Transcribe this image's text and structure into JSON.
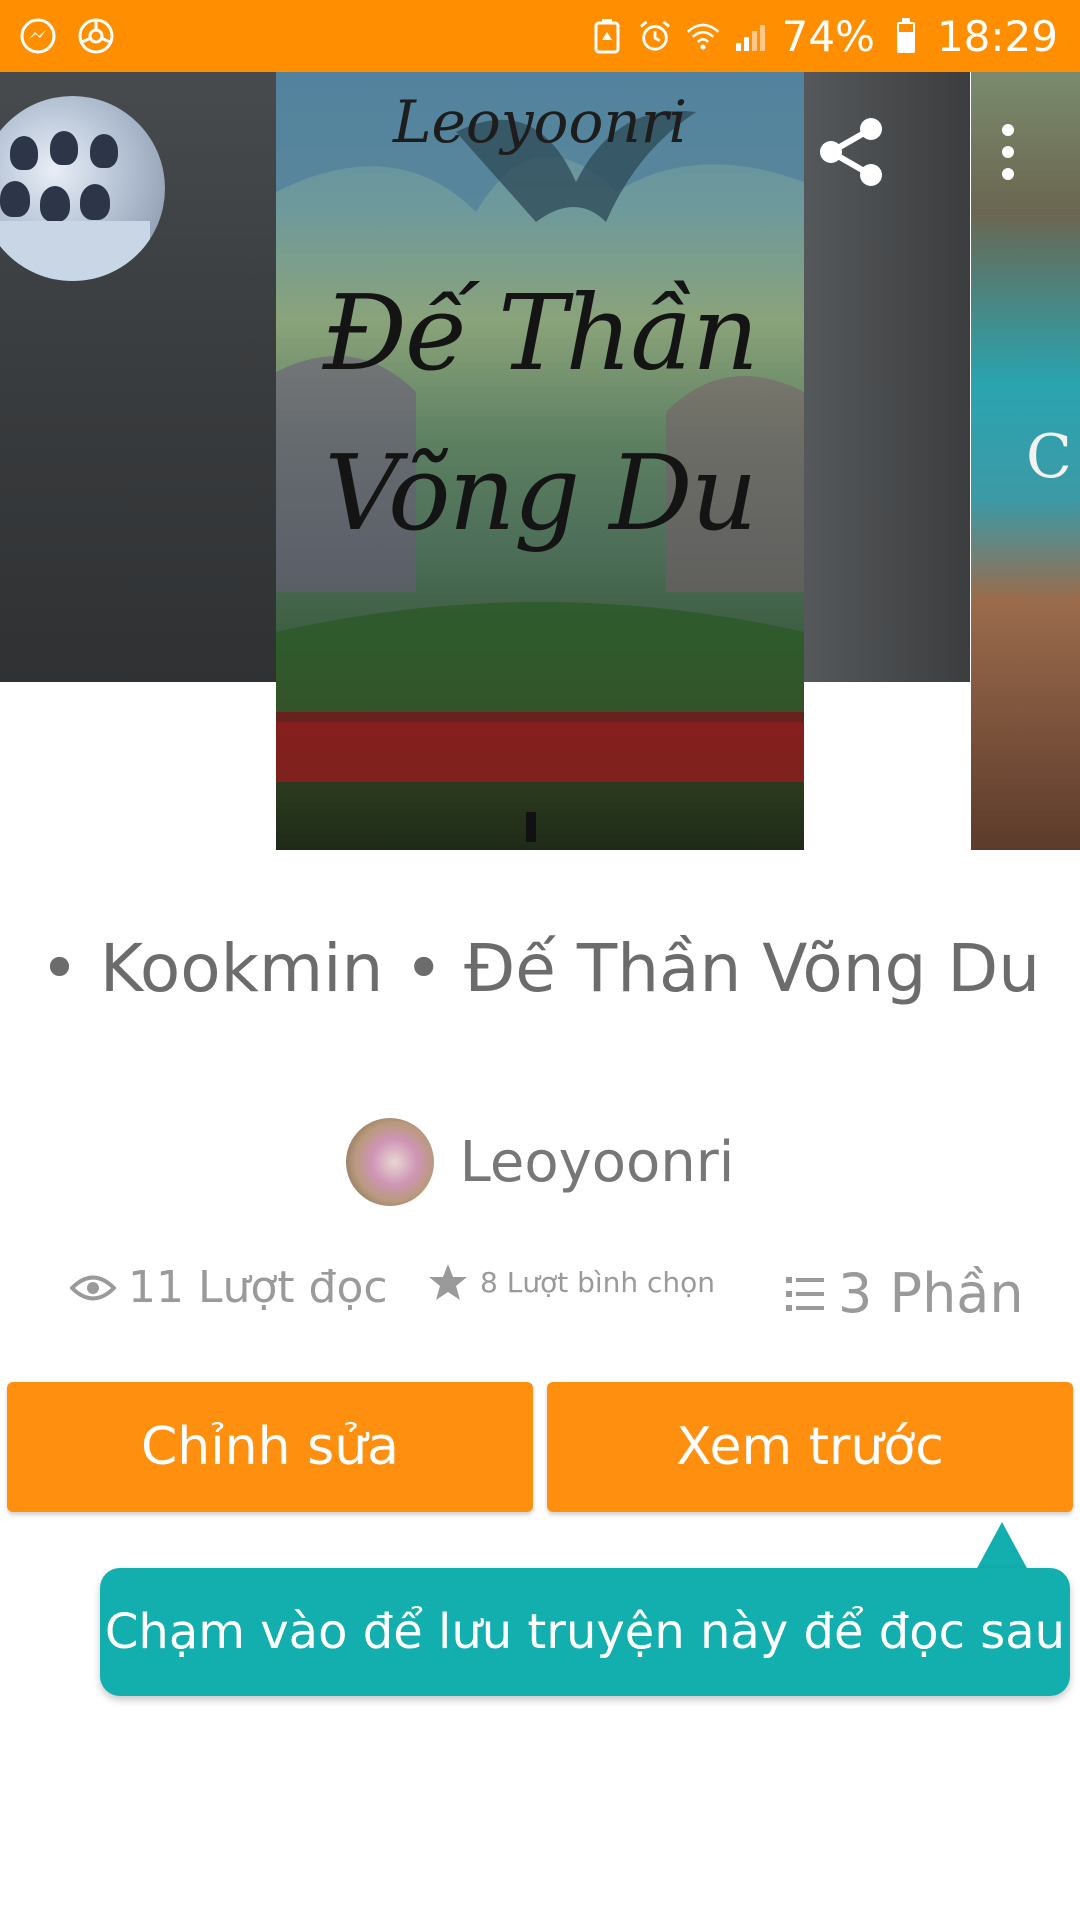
{
  "status_bar": {
    "battery_percent": "74%",
    "time": "18:29",
    "icons": [
      "messenger-icon",
      "app-icon",
      "battery-saver-icon",
      "alarm-icon",
      "wifi-icon",
      "signal-icon",
      "battery-icon"
    ]
  },
  "cover": {
    "author_signature": "Leoyoonri",
    "title_line1": "Đế Thần",
    "title_line2": "Võng Du",
    "right_peek_text": "C"
  },
  "story": {
    "title": "• Kookmin • Đế Thần Võng Du",
    "author": "Leoyoonri"
  },
  "stats": {
    "reads": "11 Lượt đọc",
    "votes": "8 Lượt bình chọn",
    "parts": "3 Phần"
  },
  "actions": {
    "edit_label": "Chỉnh sửa",
    "preview_label": "Xem trước"
  },
  "tooltip": {
    "text": "Chạm vào để lưu truyện này để đọc sau"
  },
  "colors": {
    "status_bar": "#ff8f00",
    "button": "#ff8f0f",
    "tooltip": "#13aeae"
  }
}
